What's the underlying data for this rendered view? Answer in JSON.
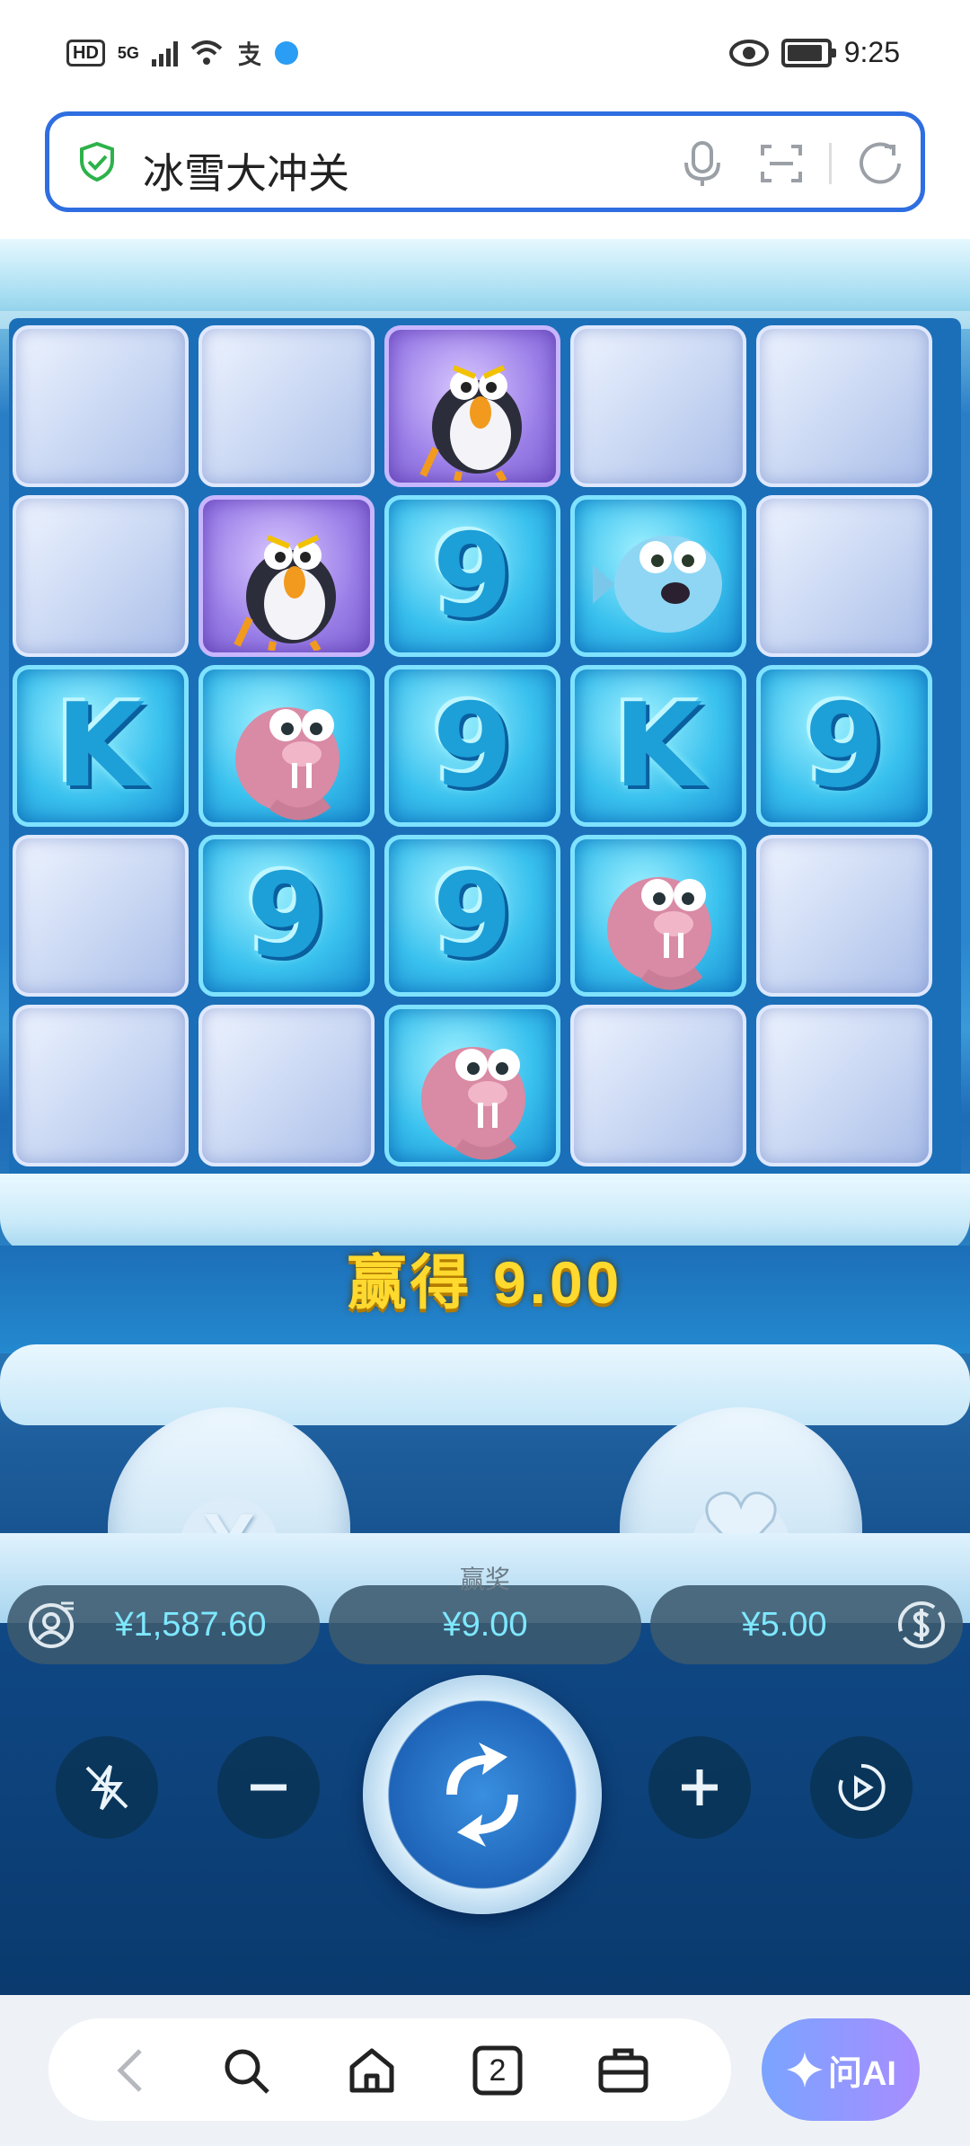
{
  "status_bar": {
    "hd": "HD",
    "network": "5G",
    "time": "9:25"
  },
  "address_bar": {
    "text": "冰雪大冲关"
  },
  "game": {
    "grid_rows": [
      [
        "stone",
        "stone",
        "penguin",
        "stone",
        "stone"
      ],
      [
        "stone",
        "penguin",
        "9",
        "pufferfish",
        "stone"
      ],
      [
        "K",
        "walrus",
        "9",
        "K",
        "9"
      ],
      [
        "stone",
        "9",
        "9",
        "walrus",
        "stone"
      ],
      [
        "stone",
        "stone",
        "walrus",
        "stone",
        "stone"
      ]
    ],
    "win_label": "赢得",
    "win_amount": "9.00",
    "igloo_left_symbol": "X",
    "igloo_right_symbol": "heart-icon",
    "balance": "¥1,587.60",
    "win_pill_label": "赢奖",
    "win_pill_value": "¥9.00",
    "bet": "¥5.00",
    "colors": {
      "win_text": "#ffd92e",
      "pill_text": "#7ee8ff"
    }
  },
  "bottom_nav": {
    "tab_count": "2",
    "ai_label": "问AI"
  }
}
